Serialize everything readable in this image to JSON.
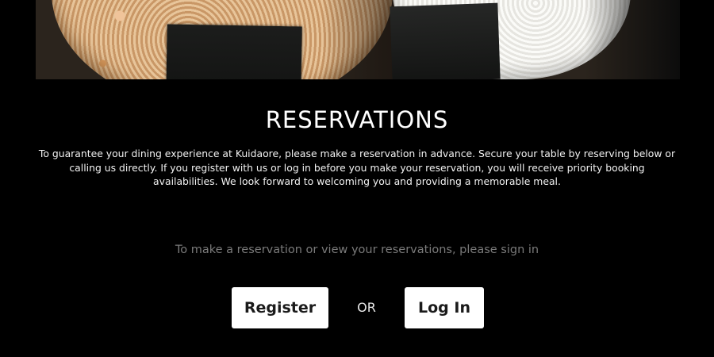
{
  "hero": {
    "image_name": "onigiri-photo"
  },
  "reservations": {
    "title": "RESERVATIONS",
    "description": "To guarantee your dining experience at Kuidaore, please make a reservation in advance. Secure your table by reserving below or calling us directly. If you register with us or log in before you make your reservation, you will receive priority booking availabilities. We look forward to welcoming you and providing a memorable meal.",
    "signin_prompt": "To make a reservation or view your reservations, please sign in",
    "register_label": "Register",
    "or_label": "OR",
    "login_label": "Log In"
  },
  "colors": {
    "background": "#000000",
    "button_bg": "#ffffff",
    "button_text": "#1a1a1a",
    "prompt_text": "#7a7a7a"
  }
}
